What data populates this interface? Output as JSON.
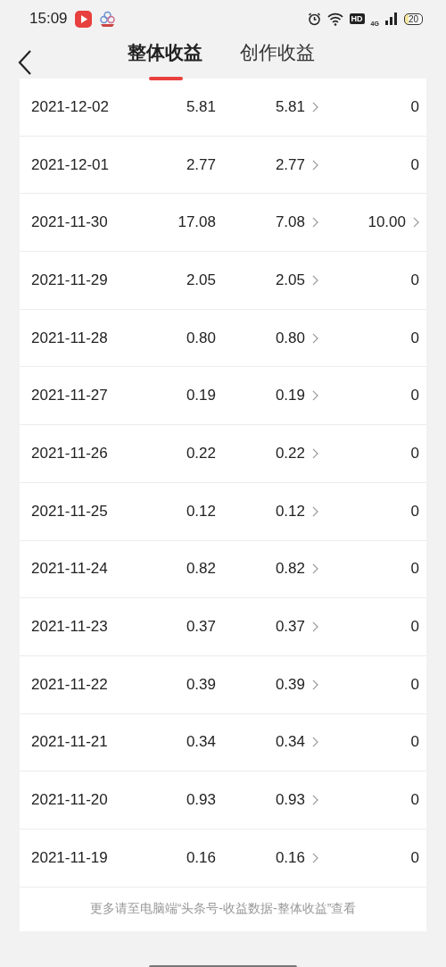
{
  "status_bar": {
    "time": "15:09",
    "hd": "HD",
    "network": "4G",
    "battery": "20"
  },
  "tabs": [
    {
      "label": "整体收益",
      "selected": true
    },
    {
      "label": "创作收益",
      "selected": false
    }
  ],
  "rows": [
    {
      "date": "2021-12-02",
      "column_2": "5.81",
      "column_3": "5.81",
      "column_4": "0",
      "column_4_link": false
    },
    {
      "date": "2021-12-01",
      "column_2": "2.77",
      "column_3": "2.77",
      "column_4": "0",
      "column_4_link": false
    },
    {
      "date": "2021-11-30",
      "column_2": "17.08",
      "column_3": "7.08",
      "column_4": "10.00",
      "column_4_link": true
    },
    {
      "date": "2021-11-29",
      "column_2": "2.05",
      "column_3": "2.05",
      "column_4": "0",
      "column_4_link": false
    },
    {
      "date": "2021-11-28",
      "column_2": "0.80",
      "column_3": "0.80",
      "column_4": "0",
      "column_4_link": false
    },
    {
      "date": "2021-11-27",
      "column_2": "0.19",
      "column_3": "0.19",
      "column_4": "0",
      "column_4_link": false
    },
    {
      "date": "2021-11-26",
      "column_2": "0.22",
      "column_3": "0.22",
      "column_4": "0",
      "column_4_link": false
    },
    {
      "date": "2021-11-25",
      "column_2": "0.12",
      "column_3": "0.12",
      "column_4": "0",
      "column_4_link": false
    },
    {
      "date": "2021-11-24",
      "column_2": "0.82",
      "column_3": "0.82",
      "column_4": "0",
      "column_4_link": false
    },
    {
      "date": "2021-11-23",
      "column_2": "0.37",
      "column_3": "0.37",
      "column_4": "0",
      "column_4_link": false
    },
    {
      "date": "2021-11-22",
      "column_2": "0.39",
      "column_3": "0.39",
      "column_4": "0",
      "column_4_link": false
    },
    {
      "date": "2021-11-21",
      "column_2": "0.34",
      "column_3": "0.34",
      "column_4": "0",
      "column_4_link": false
    },
    {
      "date": "2021-11-20",
      "column_2": "0.93",
      "column_3": "0.93",
      "column_4": "0",
      "column_4_link": false
    },
    {
      "date": "2021-11-19",
      "column_2": "0.16",
      "column_3": "0.16",
      "column_4": "0",
      "column_4_link": false
    }
  ],
  "footer_note": "更多请至电脑端“头条号-收益数据-整体收益”查看"
}
